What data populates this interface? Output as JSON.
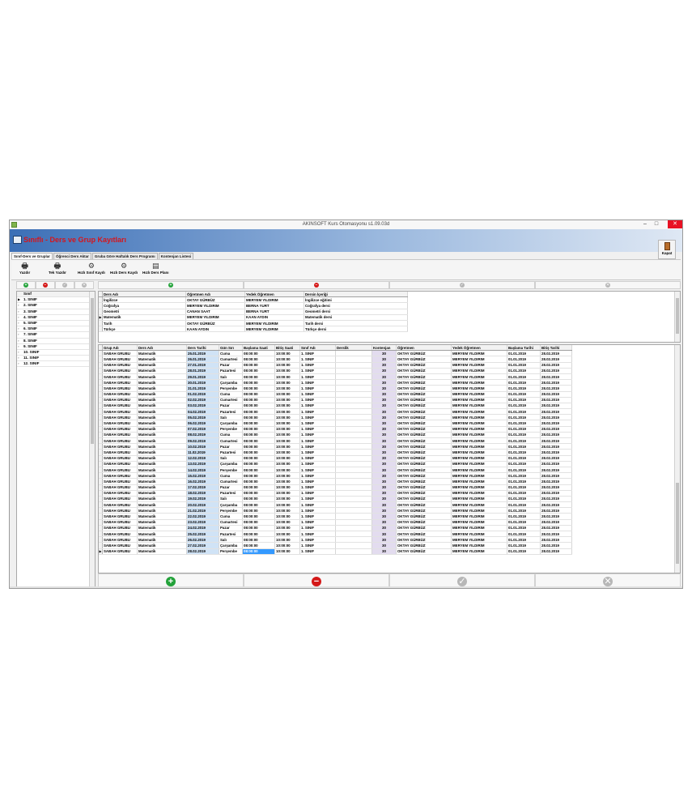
{
  "window": {
    "title": "AKINSOFT Kurs Otomasyonu s1.09.03d",
    "minimize": "–",
    "maximize": "□",
    "close": "✕"
  },
  "header": {
    "title": "Sınıflı - Ders ve Grup Kayıtları",
    "close_label": "Kapat"
  },
  "tabs": [
    "Sınıf-Ders ve Gruplar",
    "Öğrenci Ders Aktar",
    "Gruba Göre Haftalık Ders Programı",
    "Kontenjan Listesi"
  ],
  "toolbar": [
    {
      "label": "Yazdır",
      "icon": "printer-icon"
    },
    {
      "label": "Tek Yazdır",
      "icon": "printer-icon"
    },
    {
      "label": "Hızlı Sınıf Kaydı",
      "icon": "quick-class-icon"
    },
    {
      "label": "Hızlı Ders Kaydı",
      "icon": "quick-course-icon"
    },
    {
      "label": "Hızlı Ders Planı",
      "icon": "quick-plan-icon"
    }
  ],
  "colors": {
    "add": "#23a23a",
    "delete": "#d41919",
    "disabled": "#b7b7b7",
    "date_cell": "#d0e3f6",
    "quota_cell": "#e3dcef",
    "header_title": "#d7141a"
  },
  "classes": {
    "header": "Sınıf",
    "items": [
      "1. SINIF",
      "2. SINIF",
      "3. SINIF",
      "4. SINIF",
      "5. SINIF",
      "6. SINIF",
      "7. SINIF",
      "8. SINIF",
      "9. SINIF",
      "10. SINIF",
      "11. SINIF",
      "12. SINIF"
    ]
  },
  "courses": {
    "columns": [
      "Ders Adı",
      "Öğretmen Adı",
      "Yedek Öğretmen",
      "Dersin İçeriği"
    ],
    "rows": [
      [
        "İngilizce",
        "OKTAY GÜRBÜZ",
        "MERYEM YILDIRIM",
        "İngilizce eğitimi"
      ],
      [
        "Coğrafya",
        "MERYEM YILDIRIM",
        "BERNA YURT",
        "Coğrafya dersi"
      ],
      [
        "Geometri",
        "CANAN SAAT",
        "BERNA YURT",
        "Geometri dersi"
      ],
      [
        "Matematik",
        "MERYEM YILDIRIM",
        "KAAN AYDIN",
        "Matematik dersi"
      ],
      [
        "Tarih",
        "OKTAY GÜRBÜZ",
        "MERYEM YILDIRIM",
        "Tarih dersi"
      ],
      [
        "Türkçe",
        "KAAN AYDIN",
        "MERYEM YILDIRIM",
        "Türkçe dersi"
      ]
    ]
  },
  "groups": {
    "columns": [
      "Grup Adı",
      "Ders Adı",
      "Ders Tarihi",
      "Gün Sırı",
      "Başlama Saati",
      "Bitiş Saati",
      "Sınıf Adı",
      "Derslik",
      "Kontenjan",
      "Öğretmen",
      "Yedek Öğretmen",
      "Başlama Tarihi",
      "Bitiş Tarihi"
    ],
    "group_name": "SABAH GRUBU",
    "course": "Matematik",
    "start": "08:00:00",
    "end": "10:00:00",
    "class_name": "1. SINIF",
    "quota": "30",
    "teacher": "OKTAY GÜRBÜZ",
    "backup": "MERYEM YILDIRIM",
    "start_date": "01.01.2019",
    "end_date": "28.02.2019",
    "dates": [
      [
        "25.01.2019",
        "Cuma"
      ],
      [
        "26.01.2019",
        "Cumartesi"
      ],
      [
        "27.01.2019",
        "Pazar"
      ],
      [
        "28.01.2019",
        "Pazartesi"
      ],
      [
        "29.01.2019",
        "Salı"
      ],
      [
        "30.01.2019",
        "Çarşamba"
      ],
      [
        "31.01.2019",
        "Perşembe"
      ],
      [
        "01.02.2019",
        "Cuma"
      ],
      [
        "02.02.2019",
        "Cumartesi"
      ],
      [
        "03.02.2019",
        "Pazar"
      ],
      [
        "04.02.2019",
        "Pazartesi"
      ],
      [
        "05.02.2019",
        "Salı"
      ],
      [
        "06.02.2019",
        "Çarşamba"
      ],
      [
        "07.02.2019",
        "Perşembe"
      ],
      [
        "08.02.2019",
        "Cuma"
      ],
      [
        "09.02.2019",
        "Cumartesi"
      ],
      [
        "10.02.2019",
        "Pazar"
      ],
      [
        "11.02.2019",
        "Pazartesi"
      ],
      [
        "12.02.2019",
        "Salı"
      ],
      [
        "13.02.2019",
        "Çarşamba"
      ],
      [
        "14.02.2019",
        "Perşembe"
      ],
      [
        "15.02.2019",
        "Cuma"
      ],
      [
        "16.02.2019",
        "Cumartesi"
      ],
      [
        "17.02.2019",
        "Pazar"
      ],
      [
        "18.02.2019",
        "Pazartesi"
      ],
      [
        "19.02.2019",
        "Salı"
      ],
      [
        "20.02.2019",
        "Çarşamba"
      ],
      [
        "21.02.2019",
        "Perşembe"
      ],
      [
        "22.02.2019",
        "Cuma"
      ],
      [
        "23.02.2019",
        "Cumartesi"
      ],
      [
        "24.02.2019",
        "Pazar"
      ],
      [
        "25.02.2019",
        "Pazartesi"
      ],
      [
        "26.02.2019",
        "Salı"
      ],
      [
        "27.02.2019",
        "Çarşamba"
      ],
      [
        "28.02.2019",
        "Perşembe"
      ]
    ]
  },
  "nav_icons": {
    "add": "+",
    "delete": "−",
    "confirm": "✓",
    "cancel": "✕"
  }
}
